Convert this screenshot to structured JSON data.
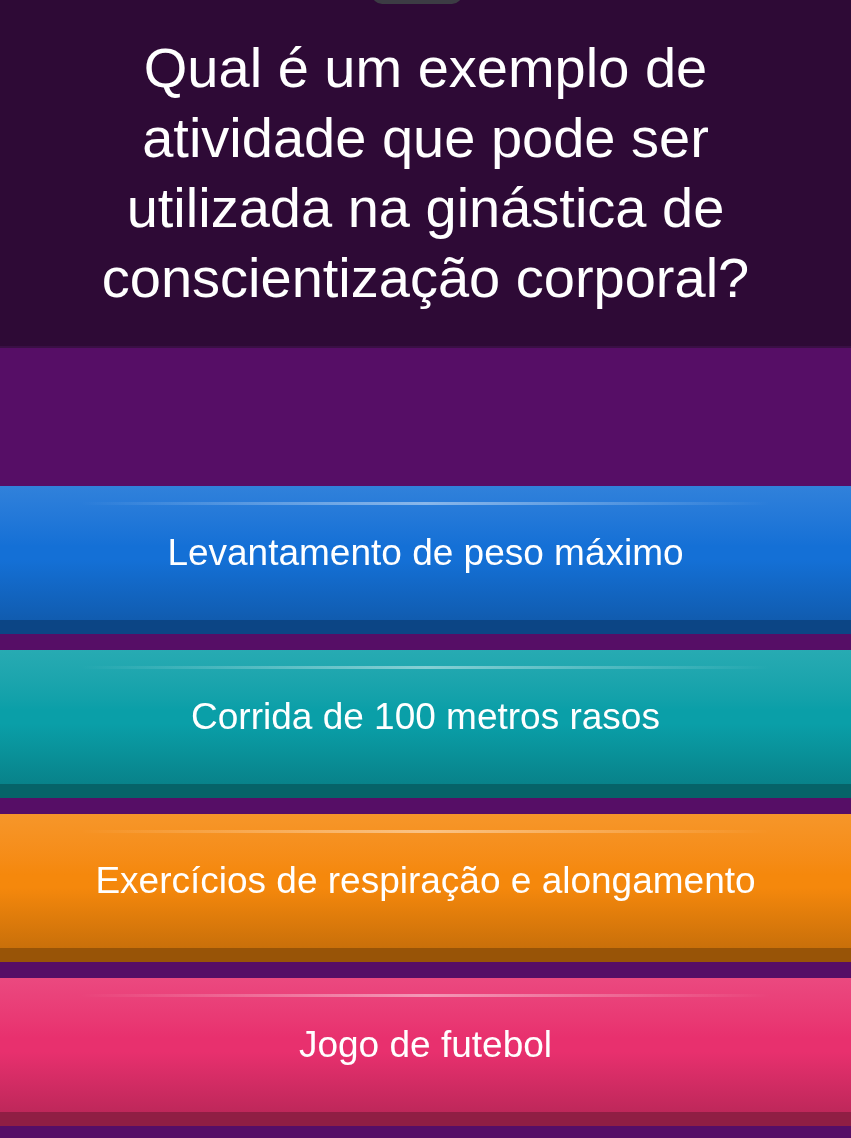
{
  "question": "Qual é um exemplo de atividade que pode ser utilizada na ginástica de conscientização corporal?",
  "answers": [
    {
      "label": "Levantamento de peso máximo",
      "color": "#1470d6"
    },
    {
      "label": "Corrida de 100 metros rasos",
      "color": "#0a9fa8"
    },
    {
      "label": "Exercícios de respiração e alongamento",
      "color": "#f5880c"
    },
    {
      "label": "Jogo de futebol",
      "color": "#e8306e"
    }
  ]
}
